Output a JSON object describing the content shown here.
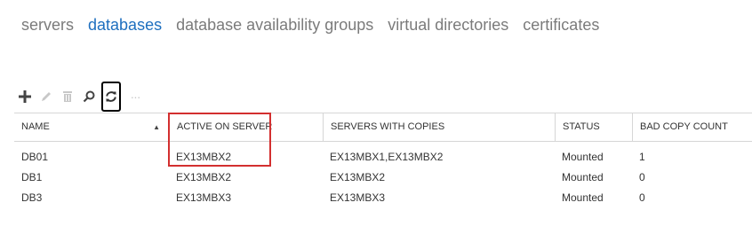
{
  "tabs": [
    {
      "label": "servers",
      "active": false
    },
    {
      "label": "databases",
      "active": true
    },
    {
      "label": "database availability groups",
      "active": false
    },
    {
      "label": "virtual directories",
      "active": false
    },
    {
      "label": "certificates",
      "active": false
    }
  ],
  "toolbar": {
    "buttons": [
      "add-icon",
      "edit-icon",
      "delete-icon",
      "search-icon",
      "refresh-icon",
      "more-icon"
    ],
    "more_label": "···"
  },
  "table": {
    "columns": [
      "NAME",
      "ACTIVE ON SERVER",
      "SERVERS WITH COPIES",
      "STATUS",
      "BAD COPY COUNT"
    ],
    "sort_indicator": "▲",
    "rows": [
      [
        "DB01",
        "EX13MBX2",
        "EX13MBX1,EX13MBX2",
        "Mounted",
        "1"
      ],
      [
        "DB1",
        "EX13MBX2",
        "EX13MBX2",
        "Mounted",
        "0"
      ],
      [
        "DB3",
        "EX13MBX3",
        "EX13MBX3",
        "Mounted",
        "0"
      ]
    ]
  },
  "colors": {
    "active_tab": "#1e6fbf",
    "inactive_tab": "#7b7b7b",
    "highlight_box": "#d32f2f"
  }
}
